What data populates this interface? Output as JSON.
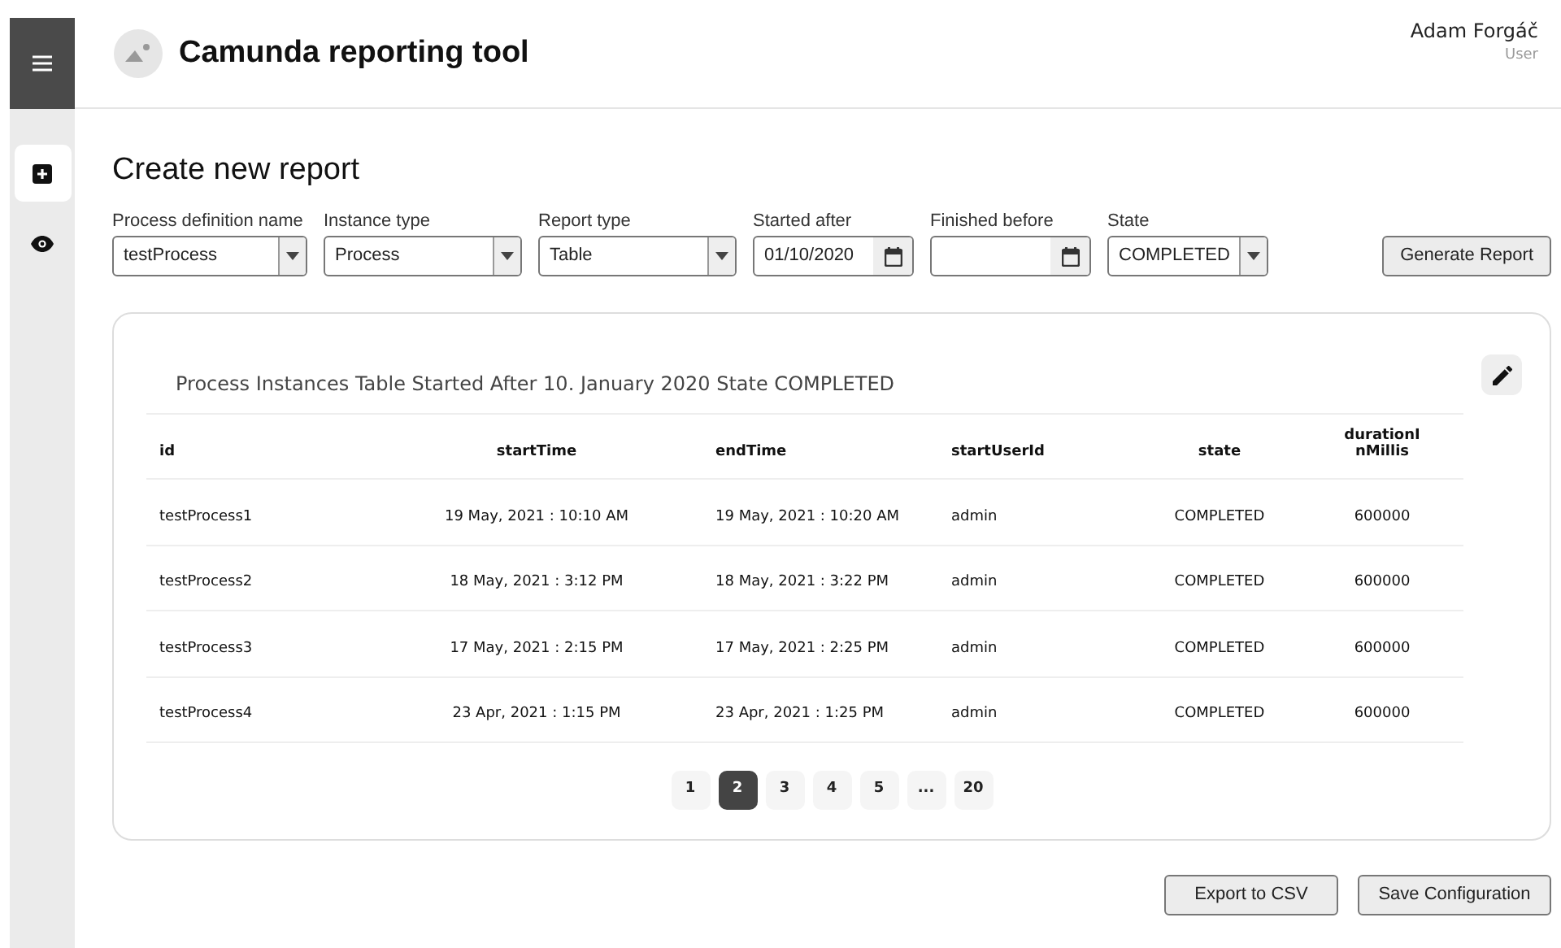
{
  "app": {
    "title": "Camunda reporting tool",
    "user_name": "Adam Forgáč",
    "user_role": "User"
  },
  "sidebar": {
    "items": [
      {
        "kind": "add",
        "selected": true
      },
      {
        "kind": "view",
        "selected": false
      }
    ]
  },
  "page": {
    "title": "Create new report"
  },
  "filters": [
    {
      "label": "Process definition name",
      "kind": "select",
      "value": "testProcess"
    },
    {
      "label": "Instance type",
      "kind": "select",
      "value": "Process"
    },
    {
      "label": "Report type",
      "kind": "select",
      "value": "Table"
    },
    {
      "label": "Started after",
      "kind": "date",
      "value": "01/10/2020"
    },
    {
      "label": "Finished before",
      "kind": "date"
    },
    {
      "label": "State",
      "kind": "select",
      "value": "COMPLETED"
    }
  ],
  "generate_button": "Generate Report",
  "report": {
    "title": "Process Instances Table Started After 10. January 2020 State COMPLETED",
    "columns": [
      "id",
      "startTime",
      "endTime",
      "startUserId",
      "state",
      "durationI nMillis"
    ],
    "rows": [
      [
        "testProcess1",
        "19 May, 2021 : 10:10 AM",
        "19 May, 2021 : 10:20 AM",
        "admin",
        "COMPLETED",
        "600000"
      ],
      [
        "testProcess2",
        "18 May, 2021 : 3:12 PM",
        "18 May, 2021 : 3:22 PM",
        "admin",
        "COMPLETED",
        "600000"
      ],
      [
        "testProcess3",
        "17 May, 2021 : 2:15 PM",
        "17 May, 2021 : 2:25 PM",
        "admin",
        "COMPLETED",
        "600000"
      ],
      [
        "testProcess4",
        "23 Apr, 2021 : 1:15 PM",
        "23 Apr, 2021 : 1:25 PM",
        "admin",
        "COMPLETED",
        "600000"
      ]
    ],
    "pages": [
      {
        "label": "1",
        "selected": false
      },
      {
        "label": "2",
        "selected": true
      },
      {
        "label": "3",
        "selected": false
      },
      {
        "label": "4",
        "selected": false
      },
      {
        "label": "5",
        "selected": false
      },
      {
        "label": "...",
        "selected": false
      },
      {
        "label": "20",
        "selected": false
      }
    ]
  },
  "actions": [
    "Export to CSV",
    "Save Configuration"
  ]
}
